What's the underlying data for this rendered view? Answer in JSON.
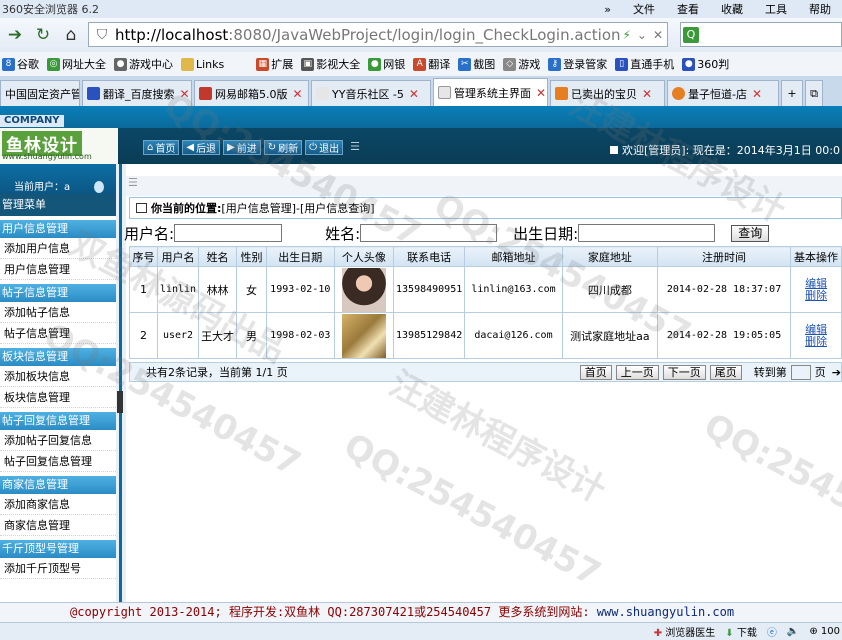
{
  "browser": {
    "title": "360安全浏览器 6.2",
    "menus": [
      "文件",
      "查看",
      "收藏",
      "工具",
      "帮助"
    ],
    "url_host": "http://localhost",
    "url_rest": ":8080/JavaWebProject/login/login_CheckLogin.action",
    "favorites": [
      "谷歌",
      "网址大全",
      "游戏中心",
      "Links",
      "扩展",
      "影视大全",
      "网银",
      "翻译",
      "截图",
      "游戏",
      "登录管家",
      "直通手机",
      "360判"
    ],
    "tabs": [
      {
        "label": "中国固定资产管理",
        "color": "#c33"
      },
      {
        "label": "翻译_百度搜索",
        "color": "#2a52be"
      },
      {
        "label": "网易邮箱5.0版",
        "color": "#c0392b"
      },
      {
        "label": "YY音乐社区 -5",
        "color": "#3a7a3a"
      },
      {
        "label": "管理系统主界面",
        "color": "#4a74b0"
      },
      {
        "label": "已卖出的宝贝",
        "color": "#e67e22"
      },
      {
        "label": "量子恒道-店",
        "color": "#e67e22"
      }
    ]
  },
  "app": {
    "company_tag": "COMPANY",
    "logo_text": "鱼林设计",
    "logo_url": "www.shuangyulin.com",
    "header_buttons": [
      "首页",
      "后退",
      "前进",
      "刷新",
      "退出"
    ],
    "welcome": "欢迎[管理员]:  现在是：2014年3月1日 00:0",
    "current_user": "当前用户：a",
    "menu_title": "管理菜单",
    "menu_groups": [
      {
        "title": "用户信息管理",
        "items": [
          "添加用户信息",
          "用户信息管理"
        ]
      },
      {
        "title": "帖子信息管理",
        "items": [
          "添加帖子信息",
          "帖子信息管理"
        ]
      },
      {
        "title": "板块信息管理",
        "items": [
          "添加板块信息",
          "板块信息管理"
        ]
      },
      {
        "title": "帖子回复信息管理",
        "items": [
          "添加帖子回复信息",
          "帖子回复信息管理"
        ]
      },
      {
        "title": "商家信息管理",
        "items": [
          "添加商家信息",
          "商家信息管理"
        ]
      },
      {
        "title": "千斤顶型号管理",
        "items": [
          "添加千斤顶型号"
        ]
      }
    ]
  },
  "main": {
    "location_label": "你当前的位置:",
    "location_path": "[用户信息管理]-[用户信息查询]",
    "search": {
      "username_label": "用户名:",
      "name_label": "姓名:",
      "birth_label": "出生日期:",
      "query_button": "查询"
    },
    "columns": [
      "序号",
      "用户名",
      "姓名",
      "性别",
      "出生日期",
      "个人头像",
      "联系电话",
      "邮箱地址",
      "家庭地址",
      "注册时间",
      "基本操作"
    ],
    "rows": [
      {
        "no": "1",
        "username": "linlin",
        "name": "林林",
        "gender": "女",
        "birth": "1993-02-10",
        "phone": "13598490951",
        "email": "linlin@163.com",
        "address": "四川成都",
        "reg": "2014-02-28 18:37:07",
        "edit": "编辑",
        "del": "删除"
      },
      {
        "no": "2",
        "username": "user2",
        "name": "王大才",
        "gender": "男",
        "birth": "1998-02-03",
        "phone": "13985129842",
        "email": "dacai@126.com",
        "address": "测试家庭地址aa",
        "reg": "2014-02-28 19:05:05",
        "edit": "编辑",
        "del": "删除"
      }
    ],
    "pager": {
      "info": "共有2条记录，当前第 1/1 页",
      "buttons": [
        "首页",
        "上一页",
        "下一页",
        "尾页"
      ],
      "goto_label": "转到第",
      "page_suffix": "页"
    }
  },
  "footer": {
    "text": "@copyright 2013-2014; 程序开发:双鱼林  QQ:287307421或254540457  更多系统到网站: ",
    "link": "www.shuangyulin.com"
  },
  "status": {
    "items": [
      "浏览器医生",
      "下载",
      "100"
    ]
  },
  "watermarks": [
    "QQ:254540457",
    "汪建林程序设计",
    "双鱼林源码出品"
  ]
}
